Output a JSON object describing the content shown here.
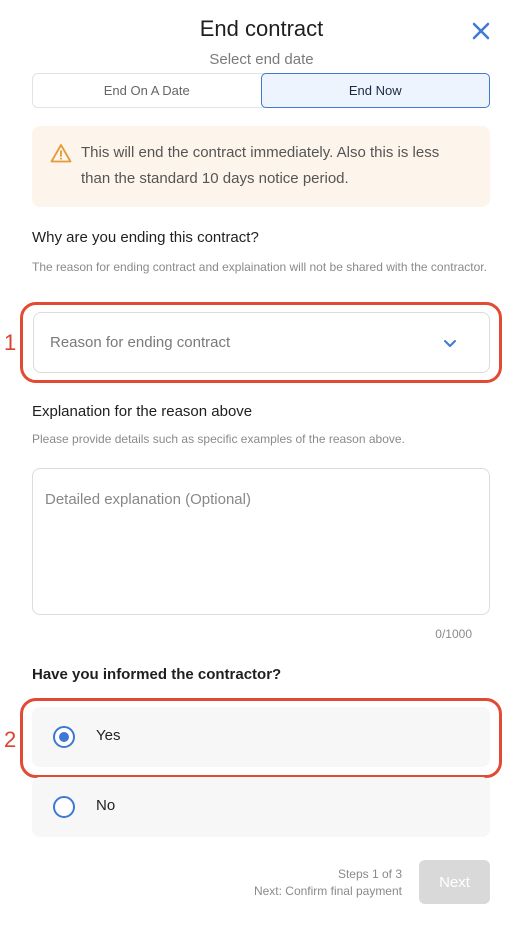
{
  "modal": {
    "title": "End contract",
    "subtitle": "Select end date",
    "close_icon": "close-icon"
  },
  "end_options": {
    "tabs": [
      {
        "label": "End On A Date",
        "selected": false
      },
      {
        "label": "End Now",
        "selected": true
      }
    ]
  },
  "alert": {
    "icon": "warning-icon",
    "text": "This will end the contract immediately. Also this is less than the standard 10 days notice period.",
    "color": "#e39a3a"
  },
  "reason": {
    "question": "Why are you ending this contract?",
    "help": "The reason for ending contract and explaination will not be shared with the contractor.",
    "placeholder": "Reason for ending contract",
    "icon": "chevron-down-icon"
  },
  "explanation": {
    "label": "Explanation for the reason above",
    "help": "Please provide details such as specific examples of the reason above.",
    "placeholder": "Detailed explanation (Optional)",
    "value": "",
    "counter": "0/1000"
  },
  "informed": {
    "question": "Have you informed the contractor?",
    "options": [
      {
        "label": "Yes",
        "checked": true
      },
      {
        "label": "No",
        "checked": false
      }
    ]
  },
  "annotations": {
    "markers": [
      "1",
      "2"
    ],
    "color": "#e24a33"
  },
  "footer": {
    "steps": "Steps 1 of 3",
    "next_step": "Next: Confirm final payment",
    "next_button": "Next",
    "next_enabled": false
  },
  "colors": {
    "accent": "#3f78d6",
    "alert_bg": "#fdf4ec"
  }
}
